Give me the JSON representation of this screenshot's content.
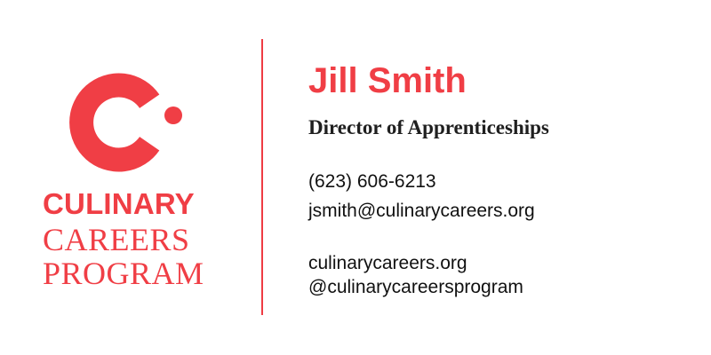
{
  "brand": {
    "logo": {
      "line1": "CULINARY",
      "line2": "CAREERS",
      "line3": "PROGRAM"
    },
    "colors": {
      "accent": "#f03e45",
      "text": "#111111",
      "background": "#ffffff"
    }
  },
  "contact": {
    "name": "Jill Smith",
    "title": "Director of Apprenticeships",
    "phone": "(623) 606-6213",
    "email": "jsmith@culinarycareers.org",
    "website": "culinarycareers.org",
    "social": "@culinarycareersprogram"
  },
  "icons": {
    "logo_mark": "c-logo-icon"
  }
}
